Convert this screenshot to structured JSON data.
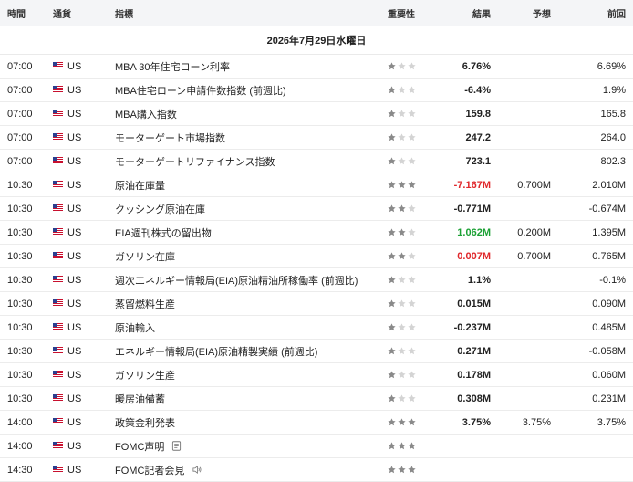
{
  "header": {
    "time": "時間",
    "currency": "通貨",
    "indicator": "指標",
    "importance": "重要性",
    "actual": "結果",
    "forecast": "予想",
    "previous": "前回"
  },
  "date_label": "2026年7月29日水曜日",
  "colors": {
    "negative": "#e0282c",
    "positive": "#1ca135",
    "star_on": "#8a8a8a",
    "star_off": "#d4d4d4"
  },
  "rows": [
    {
      "time": "07:00",
      "currency": "US",
      "indicator": "MBA 30年住宅ローン利率",
      "importance": 1,
      "actual": "6.76%",
      "actual_color": "",
      "forecast": "",
      "previous": "6.69%",
      "icon": ""
    },
    {
      "time": "07:00",
      "currency": "US",
      "indicator": "MBA住宅ローン申請件数指数 (前週比)",
      "importance": 1,
      "actual": "-6.4%",
      "actual_color": "",
      "forecast": "",
      "previous": "1.9%",
      "icon": ""
    },
    {
      "time": "07:00",
      "currency": "US",
      "indicator": "MBA購入指数",
      "importance": 1,
      "actual": "159.8",
      "actual_color": "",
      "forecast": "",
      "previous": "165.8",
      "icon": ""
    },
    {
      "time": "07:00",
      "currency": "US",
      "indicator": "モーターゲート市場指数",
      "importance": 1,
      "actual": "247.2",
      "actual_color": "",
      "forecast": "",
      "previous": "264.0",
      "icon": ""
    },
    {
      "time": "07:00",
      "currency": "US",
      "indicator": "モーターゲートリファイナンス指数",
      "importance": 1,
      "actual": "723.1",
      "actual_color": "",
      "forecast": "",
      "previous": "802.3",
      "icon": ""
    },
    {
      "time": "10:30",
      "currency": "US",
      "indicator": "原油在庫量",
      "importance": 3,
      "actual": "-7.167M",
      "actual_color": "red",
      "forecast": "0.700M",
      "previous": "2.010M",
      "icon": ""
    },
    {
      "time": "10:30",
      "currency": "US",
      "indicator": "クッシング原油在庫",
      "importance": 2,
      "actual": "-0.771M",
      "actual_color": "",
      "forecast": "",
      "previous": "-0.674M",
      "icon": ""
    },
    {
      "time": "10:30",
      "currency": "US",
      "indicator": "EIA週刊株式の留出物",
      "importance": 2,
      "actual": "1.062M",
      "actual_color": "green",
      "forecast": "0.200M",
      "previous": "1.395M",
      "icon": ""
    },
    {
      "time": "10:30",
      "currency": "US",
      "indicator": "ガソリン在庫",
      "importance": 2,
      "actual": "0.007M",
      "actual_color": "red",
      "forecast": "0.700M",
      "previous": "0.765M",
      "icon": ""
    },
    {
      "time": "10:30",
      "currency": "US",
      "indicator": "週次エネルギー情報局(EIA)原油精油所稼働率 (前週比)",
      "importance": 1,
      "actual": "1.1%",
      "actual_color": "",
      "forecast": "",
      "previous": "-0.1%",
      "icon": ""
    },
    {
      "time": "10:30",
      "currency": "US",
      "indicator": "蒸留燃料生産",
      "importance": 1,
      "actual": "0.015M",
      "actual_color": "",
      "forecast": "",
      "previous": "0.090M",
      "icon": ""
    },
    {
      "time": "10:30",
      "currency": "US",
      "indicator": "原油輸入",
      "importance": 1,
      "actual": "-0.237M",
      "actual_color": "",
      "forecast": "",
      "previous": "0.485M",
      "icon": ""
    },
    {
      "time": "10:30",
      "currency": "US",
      "indicator": "エネルギー情報局(EIA)原油精製実績 (前週比)",
      "importance": 1,
      "actual": "0.271M",
      "actual_color": "",
      "forecast": "",
      "previous": "-0.058M",
      "icon": ""
    },
    {
      "time": "10:30",
      "currency": "US",
      "indicator": "ガソリン生産",
      "importance": 1,
      "actual": "0.178M",
      "actual_color": "",
      "forecast": "",
      "previous": "0.060M",
      "icon": ""
    },
    {
      "time": "10:30",
      "currency": "US",
      "indicator": "暖房油備蓄",
      "importance": 1,
      "actual": "0.308M",
      "actual_color": "",
      "forecast": "",
      "previous": "0.231M",
      "icon": ""
    },
    {
      "time": "14:00",
      "currency": "US",
      "indicator": "政策金利発表",
      "importance": 3,
      "actual": "3.75%",
      "actual_color": "",
      "forecast": "3.75%",
      "previous": "3.75%",
      "icon": ""
    },
    {
      "time": "14:00",
      "currency": "US",
      "indicator": "FOMC声明",
      "importance": 3,
      "actual": "",
      "actual_color": "",
      "forecast": "",
      "previous": "",
      "icon": "document-icon"
    },
    {
      "time": "14:30",
      "currency": "US",
      "indicator": "FOMC記者会見",
      "importance": 3,
      "actual": "",
      "actual_color": "",
      "forecast": "",
      "previous": "",
      "icon": "speaker-icon"
    }
  ]
}
